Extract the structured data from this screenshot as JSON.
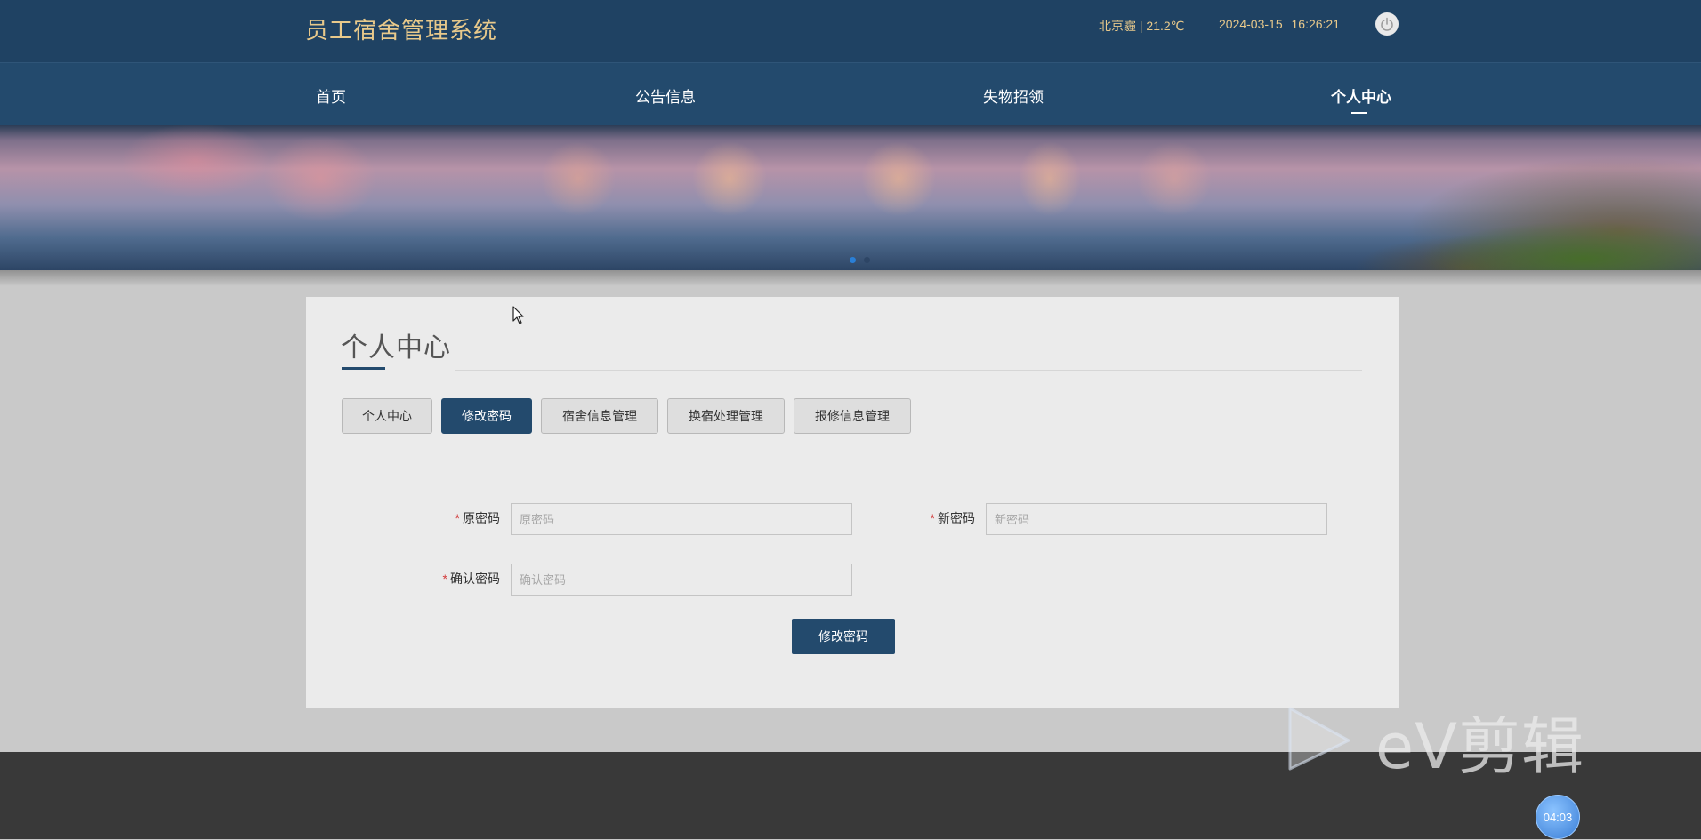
{
  "header": {
    "app_title": "员工宿舍管理系统",
    "weather": "北京霾 | 21.2℃",
    "datetime": "2024-03-15   16:26:21",
    "power_icon": "power-icon"
  },
  "nav": {
    "items": [
      {
        "label": "首页"
      },
      {
        "label": "公告信息"
      },
      {
        "label": "失物招领"
      },
      {
        "label": "个人中心"
      }
    ],
    "active_index": 3
  },
  "banner": {
    "active_dot": 0,
    "dot_count": 2,
    "dot_active_color": "#2a7fd6",
    "dot_inactive_color": "#2d4565"
  },
  "page": {
    "title": "个人中心",
    "tabs": [
      {
        "label": "个人中心"
      },
      {
        "label": "修改密码"
      },
      {
        "label": "宿舍信息管理"
      },
      {
        "label": "换宿处理管理"
      },
      {
        "label": "报修信息管理"
      }
    ],
    "active_tab": 1
  },
  "form": {
    "required_mark": "*",
    "old_password": {
      "label": "原密码",
      "placeholder": "原密码",
      "value": ""
    },
    "new_password": {
      "label": "新密码",
      "placeholder": "新密码",
      "value": ""
    },
    "confirm_password": {
      "label": "确认密码",
      "placeholder": "确认密码",
      "value": ""
    },
    "submit_label": "修改密码"
  },
  "watermark": {
    "text": "eV剪辑",
    "timer": "04:03"
  },
  "colors": {
    "header_bg": "#1f4263",
    "nav_bg": "#234a6d",
    "title_gold": "#e8c98b",
    "accent": "#234a6d",
    "required": "#d23b3b",
    "footer_bg": "#393939"
  }
}
